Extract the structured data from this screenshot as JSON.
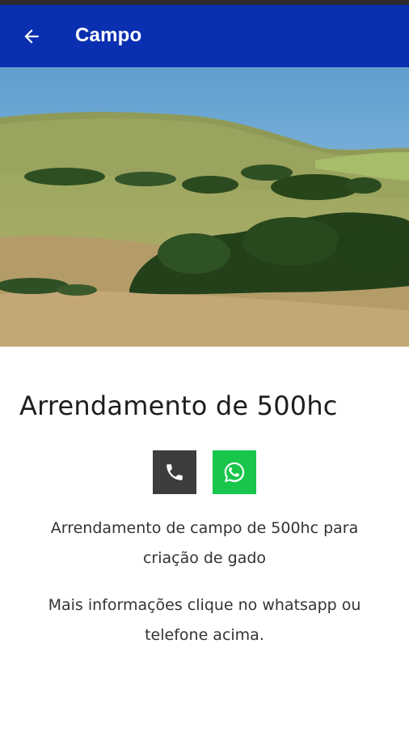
{
  "appbar": {
    "title": "Campo",
    "back_icon": "arrow-left-icon",
    "background": "#0a2fb1"
  },
  "hero_image": {
    "icon": "landscape-photo"
  },
  "listing": {
    "title": "Arrendamento de 500hc",
    "description_1_line_1": "Arrendamento de campo de 500hc para",
    "description_1_line_2": "criação de gado",
    "description_2_line_1": "Mais informações clique no whatsapp ou",
    "description_2_line_2": "telefone acima."
  },
  "contacts": {
    "phone_icon": "phone-icon",
    "phone_color": "#3d3d3d",
    "whatsapp_icon": "whatsapp-icon",
    "whatsapp_color": "#18c64c"
  }
}
